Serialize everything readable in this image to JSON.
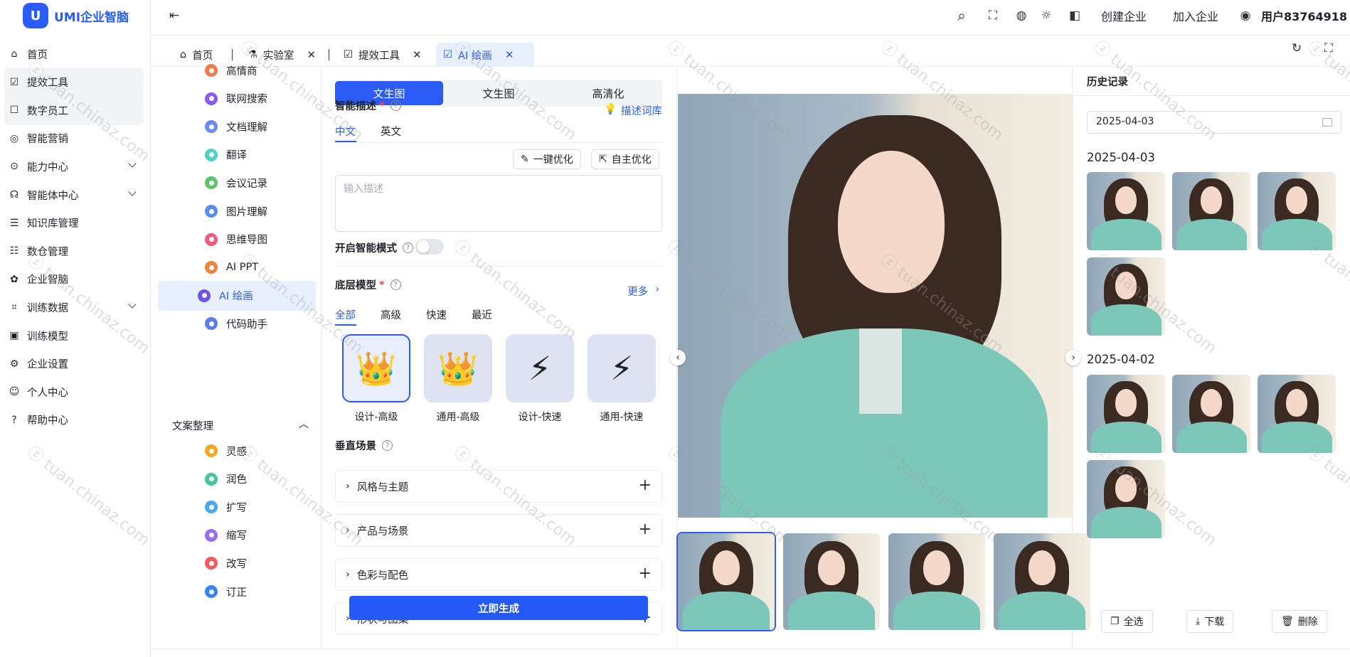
{
  "app": {
    "name": "UMI企业智脑",
    "logo_glyph": "U",
    "accent": "#2b5cf6"
  },
  "nav": {
    "items": [
      {
        "label": "首页",
        "icon": "home-icon"
      },
      {
        "label": "提效工具",
        "icon": "chart-icon",
        "active": true
      },
      {
        "label": "数字员工",
        "icon": "id-card-icon",
        "active": true
      },
      {
        "label": "智能营销",
        "icon": "target-icon"
      },
      {
        "label": "能力中心",
        "icon": "ability-icon",
        "expandable": true
      },
      {
        "label": "智能体中心",
        "icon": "robot-icon",
        "expandable": true
      },
      {
        "label": "知识库管理",
        "icon": "book-icon"
      },
      {
        "label": "数仓管理",
        "icon": "database-icon"
      },
      {
        "label": "企业智脑",
        "icon": "brain-icon"
      },
      {
        "label": "训练数据",
        "icon": "scan-icon",
        "expandable": true
      },
      {
        "label": "训练模型",
        "icon": "model-icon"
      },
      {
        "label": "企业设置",
        "icon": "settings-icon"
      },
      {
        "label": "个人中心",
        "icon": "user-icon"
      },
      {
        "label": "帮助中心",
        "icon": "help-icon"
      }
    ]
  },
  "topbar": {
    "create_company": "创建企业",
    "join_company": "加入企业",
    "username": "用户83764918",
    "collapse_glyph": "⇤",
    "search_glyph": "⌕",
    "fullscreen_glyph": "⛶",
    "language_glyph": "◍",
    "theme_glyph": "☼",
    "layout_glyph": "◧",
    "user_glyph": "◉"
  },
  "tabs": {
    "items": [
      {
        "label": "首页",
        "icon": "home-icon"
      },
      {
        "label": "实验室",
        "icon": "flask-icon",
        "closable": true
      },
      {
        "label": "提效工具",
        "icon": "chart-icon",
        "closable": true
      },
      {
        "label": "AI 绘画",
        "icon": "paint-icon",
        "closable": true,
        "active": true
      }
    ],
    "close_glyph": "✕",
    "refresh_glyph": "↻",
    "expand_glyph": "⛶"
  },
  "subnav": {
    "items": [
      {
        "label": "高情商",
        "color": "#f07b4b"
      },
      {
        "label": "联网搜索",
        "color": "#8a5cf6"
      },
      {
        "label": "文档理解",
        "color": "#6b8cf6"
      },
      {
        "label": "翻译",
        "color": "#4fd1c5"
      },
      {
        "label": "会议记录",
        "color": "#5cc46b"
      },
      {
        "label": "图片理解",
        "color": "#5b8def"
      },
      {
        "label": "思维导图",
        "color": "#ef5b7b"
      },
      {
        "label": "AI PPT",
        "color": "#f0843c"
      },
      {
        "label": "AI 绘画",
        "color": "#6a55e8",
        "active": true
      },
      {
        "label": "代码助手",
        "color": "#5b7cf6"
      }
    ],
    "group": {
      "label": "文案整理",
      "collapse_glyph": "︿"
    },
    "group_items": [
      {
        "label": "灵感",
        "color": "#f5a623"
      },
      {
        "label": "润色",
        "color": "#43c59e"
      },
      {
        "label": "扩写",
        "color": "#4aa8f0"
      },
      {
        "label": "缩写",
        "color": "#9b6cf0"
      },
      {
        "label": "改写",
        "color": "#f05b5b"
      },
      {
        "label": "订正",
        "color": "#3b82f6"
      }
    ]
  },
  "form": {
    "mode_tabs": [
      "文生图",
      "文生图",
      "高清化"
    ],
    "prompt": {
      "label": "智能描述",
      "required": "*",
      "library_link": "描述词库",
      "lang_cn": "中文",
      "lang_en": "英文",
      "one_click": "一键优化",
      "self_opt": "自主优化",
      "placeholder": "输入描述",
      "help_glyph": "?"
    },
    "smart_mode_label": "开启智能模式",
    "model": {
      "label": "底层模型",
      "required": "*",
      "more": "更多",
      "tabs": [
        "全部",
        "高级",
        "快速",
        "最近"
      ],
      "options": [
        {
          "label": "设计-高级",
          "glyph": "👑"
        },
        {
          "label": "通用-高级",
          "glyph": "👑"
        },
        {
          "label": "设计-快速",
          "glyph": "⚡"
        },
        {
          "label": "通用-快速",
          "glyph": "⚡"
        }
      ]
    },
    "scene": {
      "label": "垂直场景",
      "items": [
        "风格与主题",
        "产品与场景",
        "色彩与配色",
        "形状与图案"
      ],
      "plus_glyph": "+"
    },
    "generate_button": "立即生成"
  },
  "preview": {
    "prev_glyph": "‹",
    "next_glyph": "›",
    "thumbnail_count": 4
  },
  "history": {
    "title": "历史记录",
    "date_value": "2025-04-03",
    "groups": [
      {
        "date": "2025-04-03",
        "count": 4
      },
      {
        "date": "2025-04-02",
        "count": 4
      }
    ],
    "select_all": "全选",
    "download": "下载",
    "delete": "删除",
    "select_glyph": "❐",
    "download_glyph": "⤓",
    "delete_glyph": "🗑"
  }
}
